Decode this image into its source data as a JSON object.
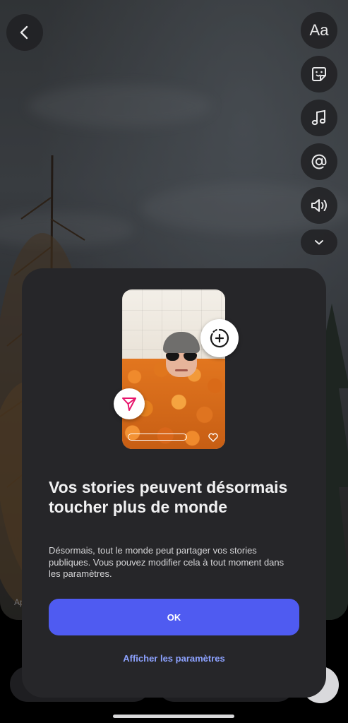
{
  "top_tools": {
    "back": "back-arrow",
    "text_label": "Aa",
    "sticker": "sticker-icon",
    "music": "music-icon",
    "mention": "at-sign-icon",
    "sound": "speaker-icon",
    "more": "chevron-down-icon"
  },
  "background_hint": "Ap",
  "modal": {
    "title": "Vos stories peuvent désormais toucher plus de monde",
    "body": "Désormais, tout le monde peut partager vos stories publiques. Vous pouvez modifier cela à tout moment dans les paramètres.",
    "ok_label": "OK",
    "settings_link": "Afficher les paramètres"
  },
  "colors": {
    "primary_button": "#4f5bf1",
    "link": "#8da2ff",
    "sheet": "#262629",
    "share_badge_icon": "#e8146c"
  }
}
